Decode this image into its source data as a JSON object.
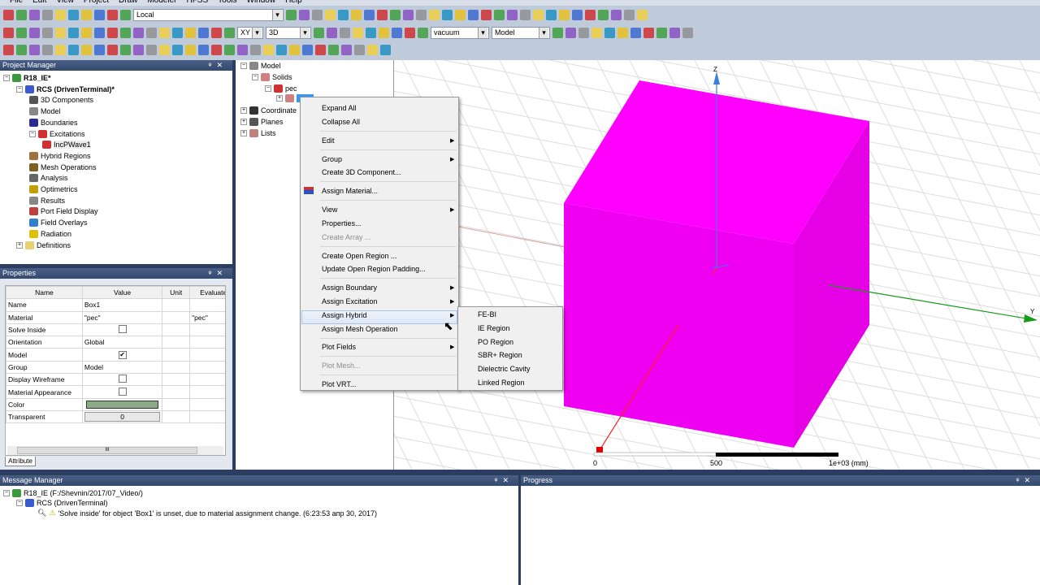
{
  "menu": [
    "File",
    "Edit",
    "View",
    "Project",
    "Draw",
    "Modeler",
    "HFSS",
    "Tools",
    "Window",
    "Help"
  ],
  "toolbar": {
    "row1_icons": [
      "new-icon",
      "open-icon",
      "save-icon",
      "cut-icon",
      "copy-icon",
      "paste-icon",
      "print-icon",
      "delete-icon",
      "undo-icon",
      "redo-icon"
    ],
    "coord_system": "Local",
    "row1b_icons": [
      "validate-icon",
      "check-icon",
      "analyze-icon",
      "results-icon",
      "fit-icon",
      "pan-icon",
      "rotate-icon",
      "rotate-x-icon",
      "rotate-y-icon",
      "rotate-z-icon",
      "zoom-icon",
      "zoom-in-icon",
      "zoom-out-icon",
      "zoom-all-icon",
      "zoom-sel-icon",
      "undo-view-icon",
      "time-icon",
      "hide-icon",
      "show-icon",
      "view-a-icon",
      "view-b-icon",
      "view-c-icon",
      "view-d-icon",
      "line-icon",
      "spline-icon",
      "arc-icon",
      "arc2-icon",
      "helix-icon"
    ],
    "row2_icons": [
      "help-icon",
      "rectangle-icon",
      "circle-icon",
      "polygon-icon",
      "ellipse-icon",
      "region-icon",
      "box-icon",
      "cylinder-icon",
      "prism-icon",
      "cone-icon",
      "sphere-icon",
      "torus-icon",
      "helix3d-icon",
      "spiral-icon",
      "bondwire-icon",
      "unit-icon",
      "point-icon",
      "plane-icon"
    ],
    "plane": "XY",
    "dimension": "3D",
    "material": "vacuum",
    "group": "Model",
    "row2b_icons": [
      "unite-icon",
      "subtract-icon",
      "intersect-icon",
      "split-icon",
      "imprint-icon",
      "move-icon",
      "rotate-obj-icon",
      "mirror-icon",
      "assign-material-icon"
    ],
    "row2c_icons": [
      "snap-grid-icon",
      "snap-vertex-icon",
      "snap-edge-icon",
      "snap-face-icon",
      "snap-center-icon",
      "snap-quadrant-icon",
      "grid-icon",
      "ruler-icon",
      "render-icon",
      "measure-icon",
      "measure2-icon"
    ],
    "row3_icons": [
      "hfss-icon",
      "boundary-icon",
      "excitation-icon",
      "mesh-icon",
      "analysis-setup-icon",
      "sweep-icon",
      "port-icon",
      "field-icon",
      "solution-icon",
      "radiation-icon",
      "antenna-icon",
      "plot-icon",
      "wave-icon",
      "far-field-icon",
      "near-field-icon",
      "line-field-icon",
      "surface-field-icon",
      "volume-field-icon",
      "fields-a-icon",
      "fields-b-icon",
      "view1-icon",
      "view2-icon",
      "view3-icon",
      "view4-icon",
      "view5-icon",
      "view6-icon",
      "view7-icon",
      "view8-icon",
      "view9-icon",
      "gen-icon"
    ]
  },
  "project_manager": {
    "title": "Project Manager",
    "items": [
      {
        "label": "R18_IE*",
        "bold": true
      },
      {
        "label": "RCS (DrivenTerminal)*",
        "bold": true
      },
      {
        "label": "3D Components"
      },
      {
        "label": "Model"
      },
      {
        "label": "Boundaries"
      },
      {
        "label": "Excitations"
      },
      {
        "label": "IncPWave1"
      },
      {
        "label": "Hybrid Regions"
      },
      {
        "label": "Mesh Operations"
      },
      {
        "label": "Analysis"
      },
      {
        "label": "Optimetrics"
      },
      {
        "label": "Results"
      },
      {
        "label": "Port Field Display"
      },
      {
        "label": "Field Overlays"
      },
      {
        "label": "Radiation"
      },
      {
        "label": "Definitions"
      }
    ]
  },
  "model_tree": {
    "items": [
      "Model",
      "Solids",
      "pec",
      "Box1",
      "Coordinate",
      "Planes",
      "Lists"
    ]
  },
  "properties": {
    "title": "Properties",
    "headers": [
      "Name",
      "Value",
      "Unit",
      "Evaluated"
    ],
    "rows": [
      {
        "name": "Name",
        "value": "Box1",
        "eval": ""
      },
      {
        "name": "Material",
        "value": "\"pec\"",
        "eval": "\"pec\""
      },
      {
        "name": "Solve Inside",
        "check": false
      },
      {
        "name": "Orientation",
        "value": "Global",
        "eval": ""
      },
      {
        "name": "Model",
        "check": true
      },
      {
        "name": "Group",
        "value": "Model",
        "eval": ""
      },
      {
        "name": "Display Wireframe",
        "check": false
      },
      {
        "name": "Material Appearance",
        "check": false
      },
      {
        "name": "Color",
        "color": "#8aaa88"
      },
      {
        "name": "Transparent",
        "button": "0"
      }
    ],
    "tab": "Attribute",
    "scroll_grip": "III"
  },
  "context_menu": {
    "items": [
      "Expand All",
      "Collapse All",
      "Edit",
      "Group",
      "Create 3D Component...",
      "Assign Material...",
      "View",
      "Properties...",
      "Create Array ...",
      "Create Open Region ...",
      "Update Open Region Padding...",
      "Assign Boundary",
      "Assign Excitation",
      "Assign Hybrid",
      "Assign Mesh Operation",
      "Plot Fields",
      "Plot Mesh...",
      "Plot VRT..."
    ],
    "submenu": [
      "FE-BI",
      "IE Region",
      "PO Region",
      "SBR+ Region",
      "Dielectric Cavity",
      "Linked Region"
    ]
  },
  "viewport": {
    "axis_z": "Z",
    "axis_y": "Y",
    "scale": [
      "0",
      "500",
      "1e+03 (mm)"
    ],
    "object_color": "#ff00ff"
  },
  "message_manager": {
    "title": "Message Manager",
    "project": "R18_IE (F:/Shevnin/2017/07_Video/)",
    "design": "RCS (DrivenTerminal)",
    "message": "'Solve inside' for object 'Box1' is unset, due to material assignment change. (6:23:53  апр 30, 2017)"
  },
  "progress": {
    "title": "Progress"
  }
}
